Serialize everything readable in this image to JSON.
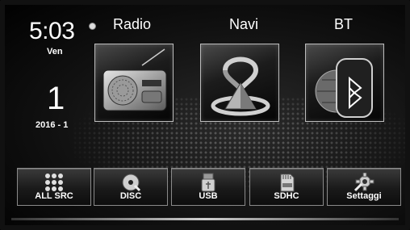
{
  "clock": {
    "time": "5:03",
    "day": "Ven",
    "date_day": "1",
    "date_year_month": "2016 - 1"
  },
  "top_menu": {
    "radio_label": "Radio",
    "navi_label": "Navi",
    "bt_label": "BT"
  },
  "bottom_menu": {
    "all_src_label": "ALL SRC",
    "disc_label": "DISC",
    "usb_label": "USB",
    "sdhc_label": "SDHC",
    "settings_label": "Settaggi"
  },
  "icons": {
    "radio": "radio-icon",
    "navi": "navigation-icon",
    "bt": "bluetooth-icon",
    "all_src": "grid-icon",
    "disc": "disc-icon",
    "usb": "usb-icon",
    "sdhc": "sd-card-icon",
    "settings": "gear-icon"
  }
}
